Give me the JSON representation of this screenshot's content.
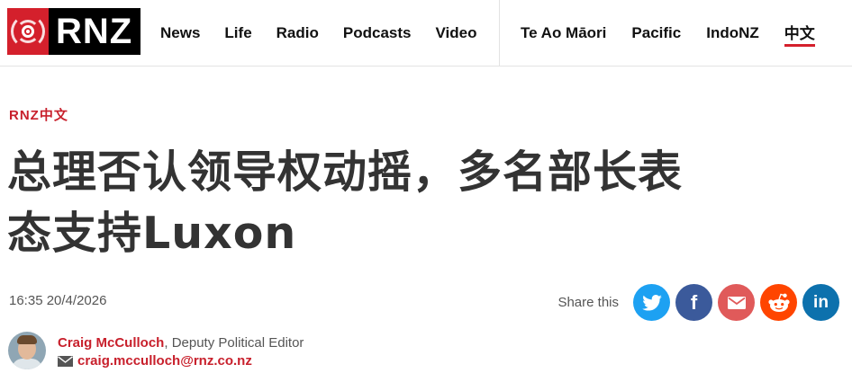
{
  "brand": {
    "logo_text": "RNZ"
  },
  "nav": {
    "main": [
      {
        "label": "News"
      },
      {
        "label": "Life"
      },
      {
        "label": "Radio"
      },
      {
        "label": "Podcasts"
      },
      {
        "label": "Video"
      }
    ],
    "secondary": [
      {
        "label": "Te Ao Māori"
      },
      {
        "label": "Pacific"
      },
      {
        "label": "IndoNZ"
      },
      {
        "label": "中文",
        "active": true
      }
    ]
  },
  "article": {
    "kicker": "RNZ中文",
    "headline_line1": "总理否认领导权动摇，多名部长表",
    "headline_line2": "态支持Luxon",
    "timestamp": "16:35 20/4/2026"
  },
  "share": {
    "label": "Share this",
    "buttons": [
      {
        "icon": "twitter-icon",
        "color": "#1da1f2"
      },
      {
        "icon": "facebook-icon",
        "color": "#3b5a9b",
        "glyph": "f"
      },
      {
        "icon": "email-icon",
        "color": "#e05a5a"
      },
      {
        "icon": "reddit-icon",
        "color": "#ff4500"
      },
      {
        "icon": "linkedin-icon",
        "color": "#0d71ad",
        "glyph": "in"
      }
    ]
  },
  "author": {
    "name": "Craig McCulloch",
    "role": ", Deputy Political Editor",
    "email": "craig.mcculloch@rnz.co.nz"
  },
  "colors": {
    "accent": "#c8202c",
    "brand_red": "#d4202c"
  }
}
